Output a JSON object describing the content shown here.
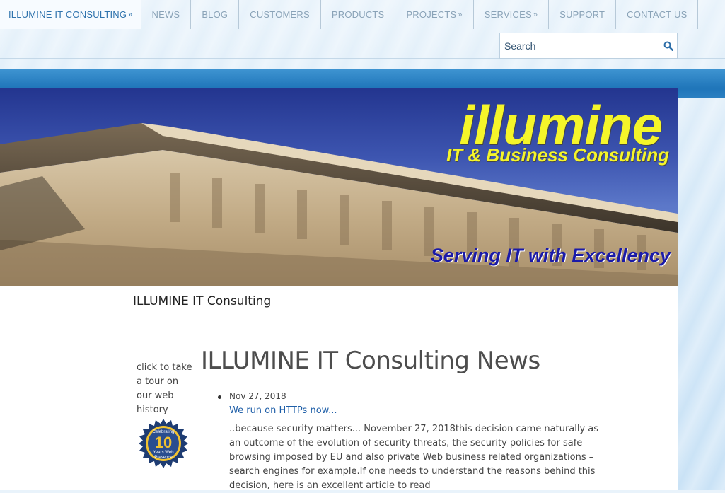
{
  "nav": {
    "items": [
      {
        "label": "ILLUMINE IT CONSULTING",
        "chevron": "»",
        "active": true
      },
      {
        "label": "NEWS"
      },
      {
        "label": "BLOG"
      },
      {
        "label": "CUSTOMERS"
      },
      {
        "label": "PRODUCTS"
      },
      {
        "label": "PROJECTS",
        "chevron": "»"
      },
      {
        "label": "SERVICES",
        "chevron": "»"
      },
      {
        "label": "SUPPORT"
      },
      {
        "label": "CONTACT US"
      }
    ]
  },
  "search": {
    "placeholder": "Search",
    "icon": "search-icon"
  },
  "banner": {
    "title": "illumine",
    "subtitle": "IT & Business Consulting",
    "tagline": "Serving IT with Excellency"
  },
  "site_name": "ILLUMINE IT Consulting",
  "sidebar": {
    "tour_text": "click to take a tour on our web history",
    "badge": {
      "line1": "Celebrating",
      "number": "10",
      "line2": "Years Web",
      "line3": "Presence"
    }
  },
  "news": {
    "heading": "ILLUMINE IT Consulting News",
    "items": [
      {
        "date": "Nov 27, 2018",
        "title": "We run on HTTPs now...",
        "excerpt": "..because security matters... November 27, 2018this decision came naturally as an outcome of the evolution of security threats, the security policies for safe browsing imposed by EU and also private Web business related organizations – search engines for example.If one needs to understand the reasons behind this decision, here is an excellent article to read"
      }
    ]
  },
  "colors": {
    "accent": "#2f73ad",
    "band": "#1f75b9",
    "banner_title": "#f5f52a",
    "banner_tagline": "#1a1aa8",
    "link": "#1f5fa8"
  }
}
